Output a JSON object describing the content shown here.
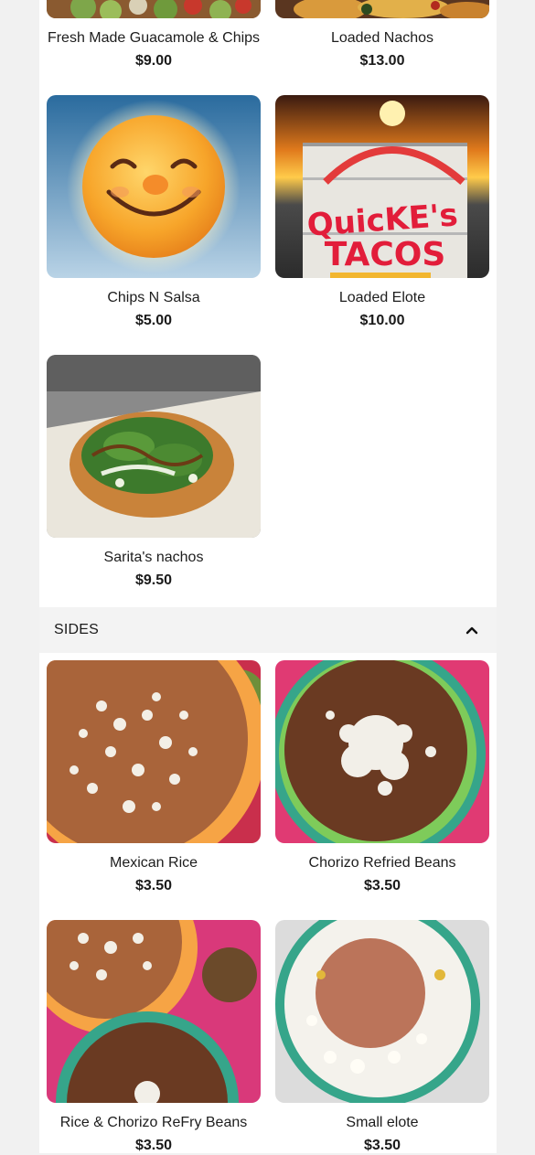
{
  "appetizers": {
    "items": [
      {
        "name": "Fresh Made Guacamole & Chips",
        "price": "$9.00",
        "image": "guacamole-photo"
      },
      {
        "name": "Loaded Nachos",
        "price": "$13.00",
        "image": "nachos-photo"
      },
      {
        "name": "Chips N Salsa",
        "price": "$5.00",
        "image": "smiling-sun-image"
      },
      {
        "name": "Loaded Elote",
        "price": "$10.00",
        "image": "tacos-sign-photo"
      },
      {
        "name": "Sarita's nachos",
        "price": "$9.50",
        "image": "saritas-nachos-photo"
      }
    ]
  },
  "sides": {
    "title": "SIDES",
    "toggle_icon": "chevron-up-icon",
    "items": [
      {
        "name": "Mexican Rice",
        "price": "$3.50",
        "image": "mexican-rice-photo"
      },
      {
        "name": "Chorizo Refried Beans",
        "price": "$3.50",
        "image": "refried-beans-photo"
      },
      {
        "name": "Rice & Chorizo ReFry Beans",
        "price": "$3.50",
        "image": "rice-beans-photo"
      },
      {
        "name": "Small elote",
        "price": "$3.50",
        "image": "small-elote-photo"
      }
    ]
  }
}
